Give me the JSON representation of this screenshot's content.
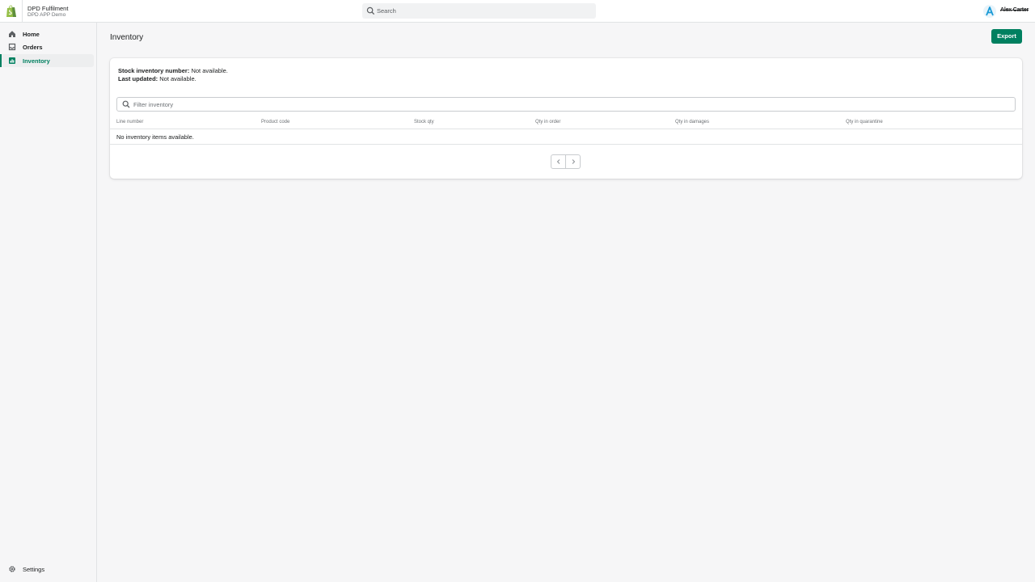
{
  "topbar": {
    "app_title": "DPD Fulfilment",
    "app_subtitle": "DPD APP Demo",
    "search_placeholder": "Search",
    "user_name": "Alex Carter",
    "logo_icon": "shopify-bag-icon",
    "avatar_icon": "avatar-letter-a-icon"
  },
  "sidebar": {
    "items": [
      {
        "label": "Home",
        "icon": "home-icon"
      },
      {
        "label": "Orders",
        "icon": "inbox-icon"
      },
      {
        "label": "Inventory",
        "icon": "inventory-icon",
        "active": true
      }
    ],
    "settings": {
      "label": "Settings",
      "icon": "gear-icon"
    }
  },
  "page": {
    "title": "Inventory",
    "export_label": "Export"
  },
  "card": {
    "stock_label": "Stock inventory number:",
    "stock_value": " Not available.",
    "updated_label": "Last updated:",
    "updated_value": " Not available.",
    "filter_placeholder": "Filter inventory",
    "columns": [
      "Line number",
      "Product code",
      "Stock qty",
      "Qty in order",
      "Qty in damages",
      "Qty in quarantine"
    ],
    "empty_message": "No inventory items available."
  },
  "colors": {
    "accent": "#008060",
    "background": "#f6f6f7",
    "surface": "#ffffff"
  }
}
